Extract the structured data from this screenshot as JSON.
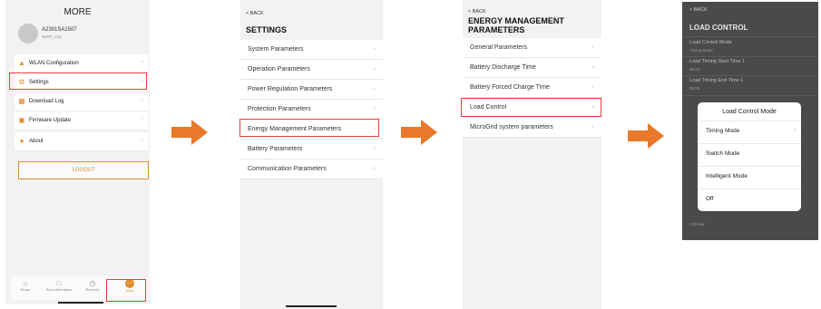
{
  "screen1": {
    "title": "MORE",
    "device_id": "A2391SA1507",
    "device_model": "SH5T_V11",
    "menu_group1": [
      {
        "label": "WLAN Configuration",
        "icon": "router-icon"
      },
      {
        "label": "Settings",
        "icon": "gear-icon"
      },
      {
        "label": "Download Log",
        "icon": "document-icon"
      },
      {
        "label": "Firmware Update",
        "icon": "book-icon"
      }
    ],
    "menu_group2": [
      {
        "label": "About",
        "icon": "info-icon"
      }
    ],
    "logout_label": "LOGOUT",
    "tabs": [
      {
        "label": "Home"
      },
      {
        "label": "Run Information"
      },
      {
        "label": "Records"
      },
      {
        "label": "More"
      }
    ]
  },
  "screen2": {
    "back_label": "< BACK",
    "title": "SETTINGS",
    "items": [
      {
        "label": "System Parameters"
      },
      {
        "label": "Operation Parameters"
      },
      {
        "label": "Power Regulation Parameters"
      },
      {
        "label": "Protection Parameters"
      },
      {
        "label": "Energy Management Parameters"
      },
      {
        "label": "Battery Parameters"
      },
      {
        "label": "Communication Parameters"
      }
    ]
  },
  "screen3": {
    "back_label": "< BACK",
    "title_line1": "ENERGY MANAGEMENT",
    "title_line2": "PARAMETERS",
    "items": [
      {
        "label": "General Parameters"
      },
      {
        "label": "Battery Discharge Time"
      },
      {
        "label": "Battery Forced Charge Time"
      },
      {
        "label": "Load Control"
      },
      {
        "label": "MicroGrid system parameters"
      }
    ]
  },
  "screen4": {
    "back_label": "< BACK",
    "title": "LOAD CONTROL",
    "fields": [
      {
        "label": "Load Control Mode",
        "value": "Timing Mode"
      },
      {
        "label": "Load Timing Start Time 1",
        "value": "00:00"
      },
      {
        "label": "Load Timing End Time 1",
        "value": "00:00"
      }
    ],
    "bottom_value": "0.00 kW",
    "modal": {
      "title": "Load Control Mode",
      "options": [
        {
          "label": "Timing Mode"
        },
        {
          "label": "Switch Mode"
        },
        {
          "label": "Intelligent Mode"
        },
        {
          "label": "Off"
        }
      ]
    }
  },
  "colors": {
    "accent": "#e38b2c",
    "highlight_border": "#e0403a",
    "arrow": "#e8782a"
  }
}
